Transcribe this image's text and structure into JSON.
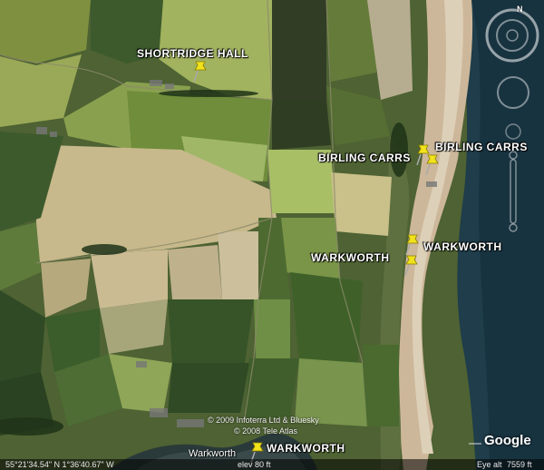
{
  "placemarks": [
    {
      "label": "SHORTRIDGE HALL"
    },
    {
      "label": "BIRLING CARRS"
    },
    {
      "label": "BIRLING CARRS"
    },
    {
      "label": "WARKWORTH"
    },
    {
      "label": "WARKWORTH"
    },
    {
      "label": "WARKWORTH"
    }
  ],
  "town_label": "Warkworth",
  "credits": {
    "line1": "© 2009 Infoterra Ltd & Bluesky",
    "line2": "© 2008 Tele Atlas"
  },
  "brand": "Google",
  "status": {
    "coords": "55°21'34.54\" N    1°36'40.67\" W",
    "elev": "elev    80 ft",
    "eye_alt_label": "Eye alt",
    "eye_alt_value": "7559 ft"
  },
  "navigation": {
    "compass_north": "N"
  },
  "colors": {
    "sea": "#1f3d4a",
    "beach": "#cdb79a",
    "field_light": "#a9b56a",
    "field_dark": "#3f5a2a",
    "pin": "#f2e21c"
  }
}
